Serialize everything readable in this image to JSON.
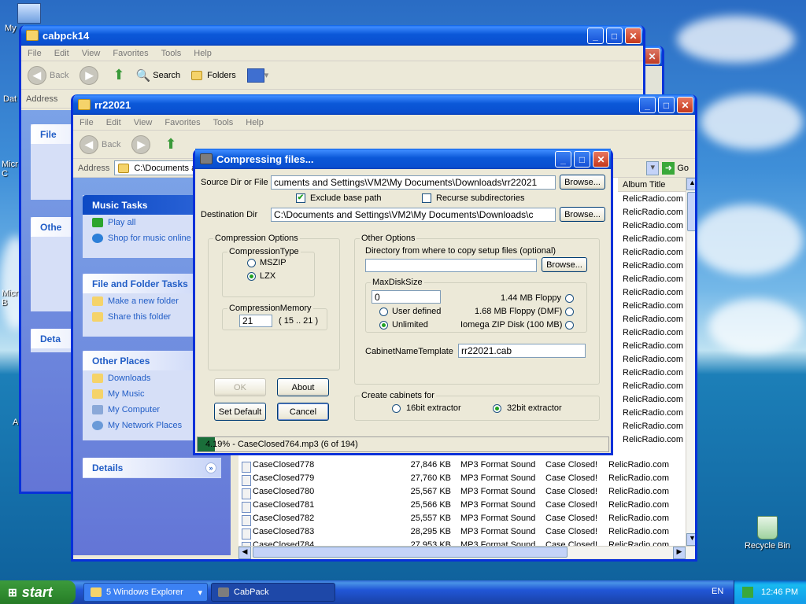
{
  "desktop": {
    "icons": [
      {
        "label": "My",
        "name": "my-computer"
      },
      {
        "label": "Dat",
        "name": "data"
      },
      {
        "label": "Micr\nC",
        "name": "microsoft-1"
      },
      {
        "label": "Micr\nB",
        "name": "microsoft-2"
      },
      {
        "label": "A",
        "name": "a-icon"
      },
      {
        "label": "Recycle Bin",
        "name": "recycle-bin"
      }
    ]
  },
  "win_back": {
    "title": "cabpck14",
    "menu": [
      "File",
      "Edit",
      "View",
      "Favorites",
      "Tools",
      "Help"
    ],
    "toolbar": {
      "back": "Back",
      "search": "Search",
      "folders": "Folders"
    },
    "address_label": "Address",
    "panels": [
      "File",
      "Othe",
      "Deta"
    ]
  },
  "win_front": {
    "title": "rr22021",
    "menu": [
      "File",
      "Edit",
      "View",
      "Favorites",
      "Tools",
      "Help"
    ],
    "toolbar": {
      "back": "Back"
    },
    "address_label": "Address",
    "address_value": "C:\\Documents ar",
    "go_label": "Go",
    "column_album": "Album Title",
    "music_tasks": {
      "title": "Music Tasks",
      "items": [
        "Play all",
        "Shop for music online"
      ]
    },
    "file_folder_tasks": {
      "title": "File and Folder Tasks",
      "items": [
        "Make a new folder",
        "Share this folder"
      ]
    },
    "other_places": {
      "title": "Other Places",
      "items": [
        "Downloads",
        "My Music",
        "My Computer",
        "My Network Places"
      ]
    },
    "details": {
      "title": "Details"
    },
    "album_rows": [
      "RelicRadio.com",
      "RelicRadio.com",
      "RelicRadio.com",
      "RelicRadio.com",
      "RelicRadio.com",
      "RelicRadio.com",
      "RelicRadio.com",
      "RelicRadio.com",
      "RelicRadio.com",
      "RelicRadio.com",
      "RelicRadio.com",
      "RelicRadio.com",
      "RelicRadio.com",
      "RelicRadio.com",
      "RelicRadio.com",
      "RelicRadio.com",
      "RelicRadio.com",
      "RelicRadio.com",
      "RelicRadio.com"
    ],
    "files": [
      {
        "name": "CaseClosed778",
        "size": "27,846 KB",
        "type": "MP3 Format Sound",
        "artist": "Case Closed!",
        "album": "RelicRadio.com"
      },
      {
        "name": "CaseClosed779",
        "size": "27,760 KB",
        "type": "MP3 Format Sound",
        "artist": "Case Closed!",
        "album": "RelicRadio.com"
      },
      {
        "name": "CaseClosed780",
        "size": "25,567 KB",
        "type": "MP3 Format Sound",
        "artist": "Case Closed!",
        "album": "RelicRadio.com"
      },
      {
        "name": "CaseClosed781",
        "size": "25,566 KB",
        "type": "MP3 Format Sound",
        "artist": "Case Closed!",
        "album": "RelicRadio.com"
      },
      {
        "name": "CaseClosed782",
        "size": "25,557 KB",
        "type": "MP3 Format Sound",
        "artist": "Case Closed!",
        "album": "RelicRadio.com"
      },
      {
        "name": "CaseClosed783",
        "size": "28,295 KB",
        "type": "MP3 Format Sound",
        "artist": "Case Closed!",
        "album": "RelicRadio.com"
      },
      {
        "name": "CaseClosed784",
        "size": "27,953 KB",
        "type": "MP3 Format Sound",
        "artist": "Case Closed!",
        "album": "RelicRadio.com"
      }
    ]
  },
  "dialog": {
    "title": "Compressing files...",
    "source_label": "Source Dir or File",
    "source_value": "cuments and Settings\\VM2\\My Documents\\Downloads\\rr22021",
    "browse": "Browse...",
    "exclude_base_path": "Exclude base path",
    "exclude_checked": true,
    "recurse_subdirs": "Recurse subdirectories",
    "recurse_checked": false,
    "dest_label": "Destination Dir",
    "dest_value": "C:\\Documents and Settings\\VM2\\My Documents\\Downloads\\c",
    "compression_options": "Compression Options",
    "compression_type": "CompressionType",
    "mszip": "MSZIP",
    "lzx": "LZX",
    "compression_memory": "CompressionMemory",
    "memory_value": "21",
    "memory_range": "( 15 .. 21 )",
    "other_options": "Other Options",
    "setup_dir_label": "Directory from where to copy setup files (optional)",
    "setup_dir_value": "",
    "max_disk_size": "MaxDiskSize",
    "max_disk_value": "0",
    "user_defined": "User defined",
    "unlimited": "Unlimited",
    "floppy_144": "1.44 MB Floppy",
    "floppy_168": "1.68 MB Floppy (DMF)",
    "iomega": "Iomega ZIP Disk (100 MB)",
    "cabinet_template_label": "CabinetNameTemplate",
    "cabinet_template_value": "rr22021.cab",
    "ok": "OK",
    "about": "About",
    "set_default": "Set Default",
    "cancel": "Cancel",
    "create_cabinets_for": "Create cabinets for",
    "bit16": "16bit extractor",
    "bit32": "32bit extractor",
    "progress_percent": 4.19,
    "status_text": "4.19% - CaseClosed764.mp3 (6 of 194)"
  },
  "taskbar": {
    "start": "start",
    "explorer_group": "5 Windows Explorer",
    "cabpack": "CabPack",
    "lang": "EN",
    "clock": "12:46 PM"
  }
}
